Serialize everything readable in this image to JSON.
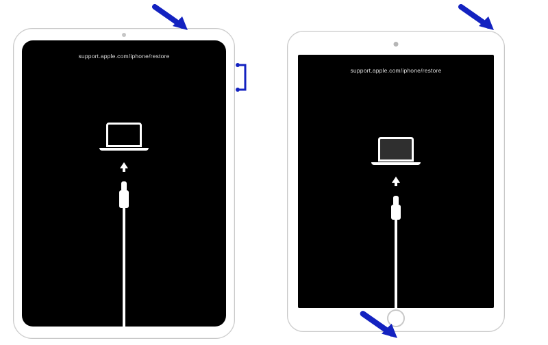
{
  "recovery_url": "support.apple.com/iphone/restore",
  "arrow_color": "#1322c0",
  "devices": {
    "ipad_pro": {
      "label": "ipad-pro-no-home-button"
    },
    "ipad_home": {
      "label": "ipad-with-home-button"
    }
  },
  "hints": {
    "arrow_top_left": "top-button",
    "arrow_top_right": "top-button",
    "arrow_home": "home-button",
    "volume_bracket": "volume-buttons"
  }
}
